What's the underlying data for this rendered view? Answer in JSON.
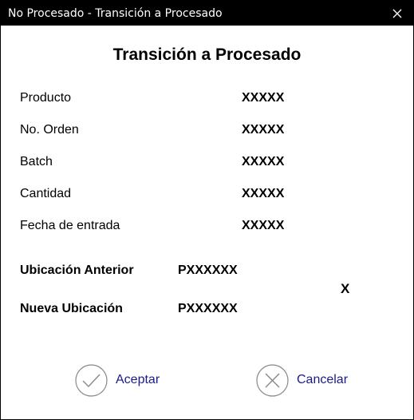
{
  "window": {
    "title": "No Procesado - Transición a Procesado"
  },
  "dialog": {
    "heading": "Transición a Procesado",
    "fields": [
      {
        "label": "Producto",
        "value": "XXXXX"
      },
      {
        "label": "No. Orden",
        "value": "XXXXX"
      },
      {
        "label": "Batch",
        "value": "XXXXX"
      },
      {
        "label": "Cantidad",
        "value": "XXXXX"
      },
      {
        "label": "Fecha de entrada",
        "value": "XXXXX"
      }
    ],
    "location": {
      "previous_label": "Ubicación Anterior",
      "previous_value": "PXXXXXX",
      "new_label": "Nueva Ubicación",
      "new_value": "PXXXXXX",
      "clear_symbol": "X"
    }
  },
  "actions": {
    "accept_label": "Aceptar",
    "cancel_label": "Cancelar"
  },
  "icons": {
    "close": "close-icon",
    "accept": "check-circle-icon",
    "cancel": "x-circle-icon"
  },
  "colors": {
    "titlebar": "#000000",
    "action_text": "#1a1a8c",
    "icon_stroke": "#888888"
  }
}
